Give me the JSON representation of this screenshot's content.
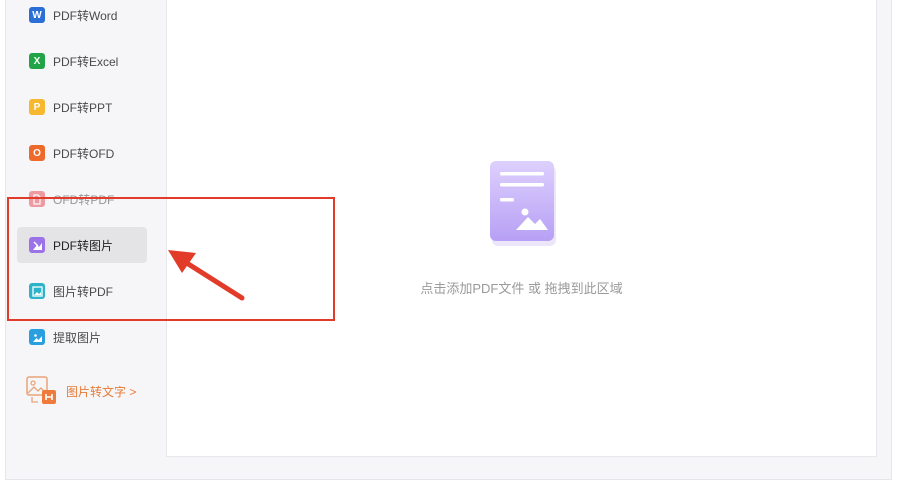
{
  "sidebar": {
    "items": [
      {
        "label": "PDF转Word",
        "icon": "word-icon",
        "icon_letter": "W",
        "color": "#2b6fd6"
      },
      {
        "label": "PDF转Excel",
        "icon": "excel-icon",
        "icon_letter": "X",
        "color": "#21a447"
      },
      {
        "label": "PDF转PPT",
        "icon": "ppt-icon",
        "icon_letter": "P",
        "color": "#f5b82e"
      },
      {
        "label": "PDF转OFD",
        "icon": "ofd-icon",
        "icon_letter": "O",
        "color": "#ee6a2b"
      },
      {
        "label": "OFD转PDF",
        "icon": "pdf-icon",
        "color": "#e8505b"
      },
      {
        "label": "PDF转图片",
        "icon": "pdf-to-image-icon",
        "color": "#9b72e8",
        "active": true
      },
      {
        "label": "图片转PDF",
        "icon": "image-to-pdf-icon",
        "color": "#2bb3c9"
      },
      {
        "label": "提取图片",
        "icon": "extract-image-icon",
        "color": "#2a9fe0"
      }
    ],
    "ocr_link": {
      "label": "图片转文字 >",
      "icon": "image-ocr-icon",
      "color": "#e87a35"
    }
  },
  "main": {
    "drop_hint": "点击添加PDF文件 或 拖拽到此区域",
    "drop_icon": "document-image-icon",
    "icon_color": "#c9b5fb"
  },
  "annotations": {
    "highlight_color": "#e23b2a",
    "arrow_icon": "red-arrow-icon"
  }
}
